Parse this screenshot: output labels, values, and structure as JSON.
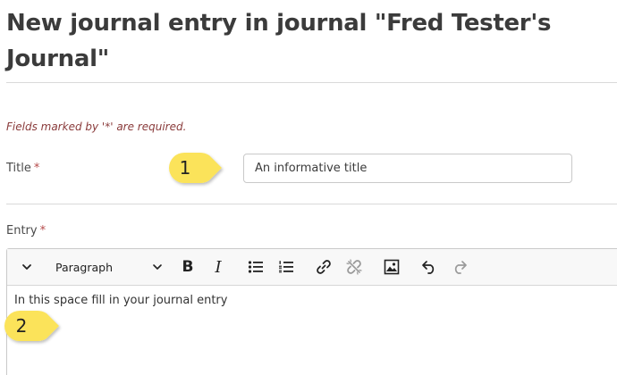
{
  "page": {
    "title": "New journal entry in journal \"Fred Tester's Journal\"",
    "required_note": "Fields marked by '*' are required."
  },
  "form": {
    "title_label": "Title",
    "title_required_marker": "*",
    "title_value": "An informative title",
    "entry_label": "Entry",
    "entry_required_marker": "*"
  },
  "editor": {
    "toolbar": {
      "collapse_icon": "chevron-down-icon",
      "block_format": "Paragraph",
      "bold_label": "B",
      "italic_label": "I",
      "buttons": [
        "bold-icon",
        "italic-icon",
        "bullet-list-icon",
        "numbered-list-icon",
        "link-icon",
        "unlink-icon",
        "image-icon",
        "undo-icon",
        "redo-icon"
      ]
    },
    "content": "In this space fill in your journal entry"
  },
  "callouts": {
    "first": "1",
    "second": "2",
    "color": "#fbe35a"
  },
  "colors": {
    "heading": "#3b3b3b",
    "required_note": "#8a3b3b",
    "required_marker": "#b54a4a",
    "toolbar_bg": "#f8f8f8"
  }
}
